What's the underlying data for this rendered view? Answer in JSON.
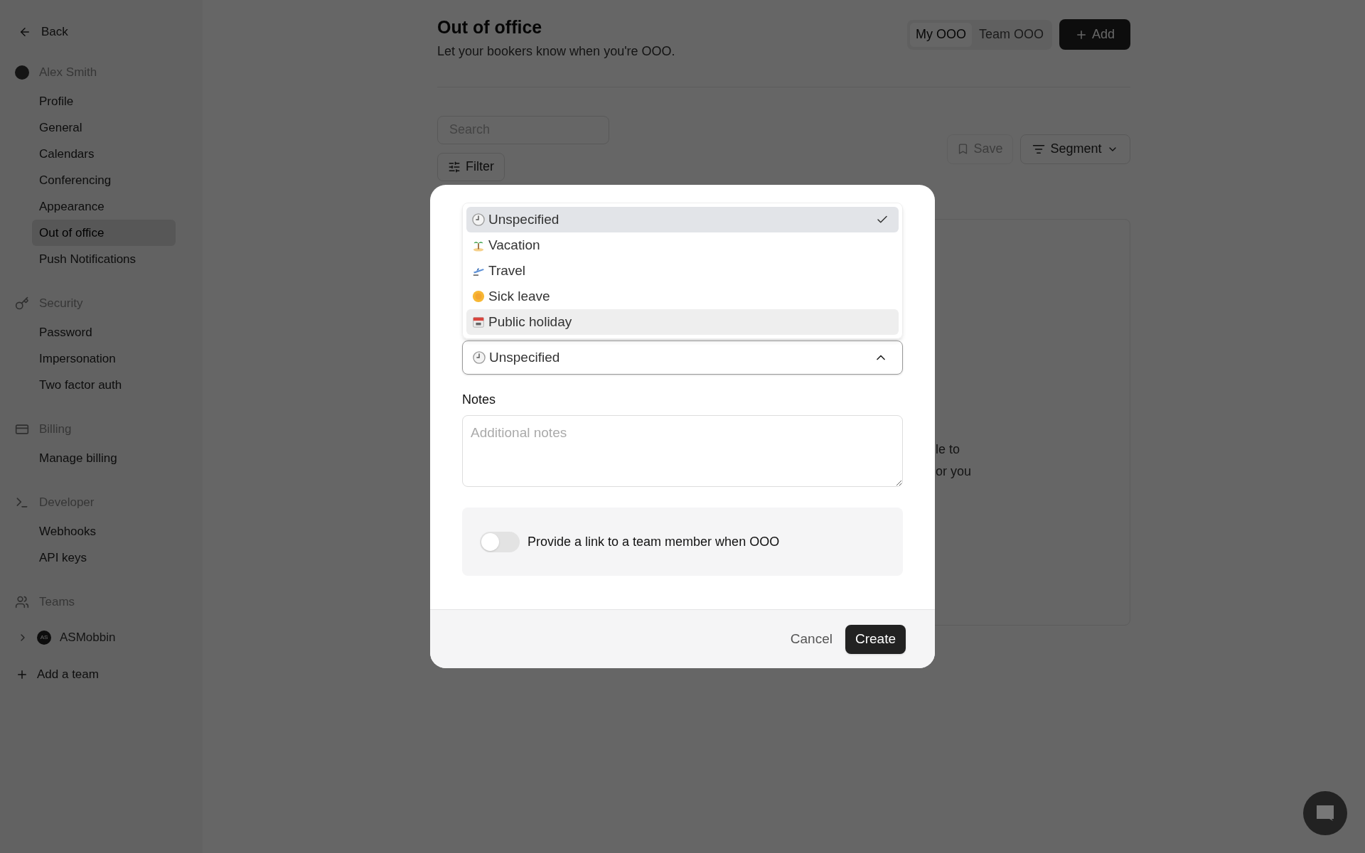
{
  "sidebar": {
    "back": "Back",
    "sections": [
      {
        "kind": "user",
        "label": "Alex Smith",
        "items": [
          {
            "label": "Profile",
            "selected": false
          },
          {
            "label": "General",
            "selected": false
          },
          {
            "label": "Calendars",
            "selected": false
          },
          {
            "label": "Conferencing",
            "selected": false
          },
          {
            "label": "Appearance",
            "selected": false
          },
          {
            "label": "Out of office",
            "selected": true
          },
          {
            "label": "Push Notifications",
            "selected": false
          }
        ]
      },
      {
        "kind": "security",
        "label": "Security",
        "items": [
          {
            "label": "Password",
            "selected": false
          },
          {
            "label": "Impersonation",
            "selected": false
          },
          {
            "label": "Two factor auth",
            "selected": false
          }
        ]
      },
      {
        "kind": "billing",
        "label": "Billing",
        "items": [
          {
            "label": "Manage billing",
            "selected": false
          }
        ]
      },
      {
        "kind": "developer",
        "label": "Developer",
        "items": [
          {
            "label": "Webhooks",
            "selected": false
          },
          {
            "label": "API keys",
            "selected": false
          }
        ]
      },
      {
        "kind": "teams",
        "label": "Teams"
      }
    ],
    "team": {
      "initials": "AS",
      "name": "ASMobbin"
    },
    "add_team": "Add a team"
  },
  "header": {
    "title": "Out of office",
    "subtitle": "Let your bookers know when you're OOO.",
    "tabs": [
      {
        "label": "My OOO",
        "selected": true
      },
      {
        "label": "Team OOO",
        "selected": false
      }
    ],
    "add_button": "Add"
  },
  "toolbar": {
    "search_placeholder": "Search",
    "filter": "Filter",
    "save": "Save",
    "segment": "Segment"
  },
  "background_text": [
    "le to",
    "or you"
  ],
  "modal": {
    "options": [
      {
        "kind": "clock",
        "label": "Unspecified",
        "selected": true,
        "highlighted": true
      },
      {
        "kind": "palm",
        "label": "Vacation",
        "selected": false,
        "highlighted": false
      },
      {
        "kind": "plane",
        "label": "Travel",
        "selected": false,
        "highlighted": false
      },
      {
        "kind": "sick",
        "label": "Sick leave",
        "selected": false,
        "highlighted": false
      },
      {
        "kind": "calendar",
        "label": "Public holiday",
        "selected": false,
        "highlighted": true
      }
    ],
    "select": {
      "kind": "clock",
      "value": "Unspecified",
      "expanded": true
    },
    "notes_label": "Notes",
    "notes_placeholder": "Additional notes",
    "toggle": {
      "label": "Provide a link to a team member when OOO",
      "on": false
    },
    "cancel": "Cancel",
    "create": "Create"
  }
}
